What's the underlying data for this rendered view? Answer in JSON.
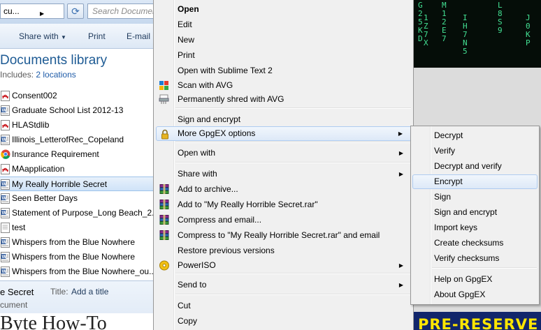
{
  "explorer": {
    "address_text": "cu...",
    "search_placeholder": "Search Documents",
    "toolbar": {
      "share_with": "Share with",
      "print": "Print",
      "email": "E-mail"
    },
    "library_title": "Documents library",
    "includes_label": "Includes:",
    "includes_link": "2 locations",
    "files": [
      {
        "name": "Consent002",
        "icon": "pdf-icon"
      },
      {
        "name": "Graduate School List 2012-13",
        "icon": "word-doc-icon"
      },
      {
        "name": "HLAStdlib",
        "icon": "pdf-icon"
      },
      {
        "name": "Illinois_LetterofRec_Copeland",
        "icon": "word-doc-icon"
      },
      {
        "name": "Insurance Requirement",
        "icon": "chrome-icon"
      },
      {
        "name": "MAapplication",
        "icon": "pdf-icon"
      },
      {
        "name": "My Really Horrible Secret",
        "icon": "word-doc-icon",
        "selected": true
      },
      {
        "name": "Seen Better Days",
        "icon": "word-doc-icon"
      },
      {
        "name": "Statement of Purpose_Long Beach_2...",
        "icon": "word-doc-icon"
      },
      {
        "name": "test",
        "icon": "text-file-icon"
      },
      {
        "name": "Whispers from the Blue Nowhere",
        "icon": "word-doc-icon"
      },
      {
        "name": "Whispers from the Blue Nowhere",
        "icon": "word-doc-icon"
      },
      {
        "name": "Whispers from the Blue Nowhere_ou...",
        "icon": "word-doc-icon"
      }
    ],
    "details": {
      "name": "e Secret",
      "title_label": "Title:",
      "title_value": "Add a title",
      "type": "cument"
    },
    "background_text": "Byte How-To"
  },
  "context_menu": {
    "items": [
      {
        "label": "Open",
        "bold": true
      },
      {
        "label": "Edit"
      },
      {
        "label": "New"
      },
      {
        "label": "Print"
      },
      {
        "label": "Open with Sublime Text 2"
      },
      {
        "label": "Scan with AVG",
        "icon": "avg-icon"
      },
      {
        "label": "Permanently shred with AVG",
        "icon": "shredder-icon"
      },
      {
        "label": "Sign and encrypt"
      },
      {
        "label": "More GpgEX options",
        "icon": "lock-icon",
        "submenu": true
      },
      {
        "label": "Open with",
        "submenu": true
      },
      {
        "label": "Share with",
        "submenu": true
      },
      {
        "label": "Add to archive...",
        "icon": "winrar-icon"
      },
      {
        "label": "Add to \"My Really Horrible Secret.rar\"",
        "icon": "winrar-icon"
      },
      {
        "label": "Compress and email...",
        "icon": "winrar-icon"
      },
      {
        "label": "Compress to \"My Really Horrible Secret.rar\" and email",
        "icon": "winrar-icon"
      },
      {
        "label": "Restore previous versions"
      },
      {
        "label": "PowerISO",
        "icon": "poweriso-icon",
        "submenu": true
      },
      {
        "label": "Send to",
        "submenu": true
      },
      {
        "label": "Cut"
      },
      {
        "label": "Copy"
      }
    ]
  },
  "gpgex_submenu": {
    "items": [
      {
        "label": "Decrypt"
      },
      {
        "label": "Verify"
      },
      {
        "label": "Decrypt and verify"
      },
      {
        "label": "Encrypt"
      },
      {
        "label": "Sign"
      },
      {
        "label": "Sign and encrypt"
      },
      {
        "label": "Import keys"
      },
      {
        "label": "Create checksums"
      },
      {
        "label": "Verify checksums"
      },
      {
        "label": "Help on GpgEX"
      },
      {
        "label": "About GpgEX"
      }
    ]
  },
  "background": {
    "matrix_columns": [
      "G25KD",
      "1Z7X",
      "M12E7",
      "IH7N5",
      "L8S9",
      "J0KP"
    ],
    "banner_text": "PRE-RESERVE"
  },
  "colors": {
    "library_title": "#1e5b94",
    "link": "#1f5ca8",
    "highlight_border": "#aecbf0",
    "matrix_green": "#43e093",
    "banner_bg": "#11266b",
    "banner_text": "#ffe600"
  }
}
